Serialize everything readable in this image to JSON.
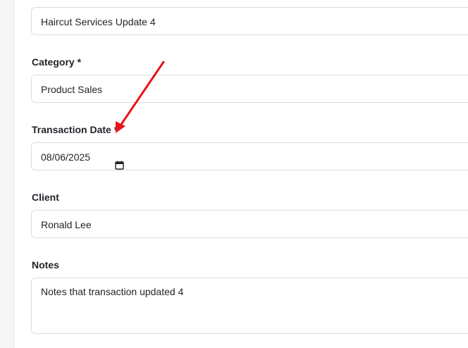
{
  "title_field": {
    "value": "Haircut Services Update 4"
  },
  "category": {
    "label": "Category *",
    "value": "Product Sales"
  },
  "transaction_date": {
    "label": "Transaction Date *",
    "value": "08/06/2025"
  },
  "client": {
    "label": "Client",
    "value": "Ronald Lee"
  },
  "notes": {
    "label": "Notes",
    "value": "Notes that transaction updated 4"
  },
  "icons": {
    "date_picker": "calendar-icon"
  },
  "colors": {
    "annotation_arrow": "#e8141a",
    "field_border": "#d9dce1",
    "background": "#f5f6f8"
  }
}
